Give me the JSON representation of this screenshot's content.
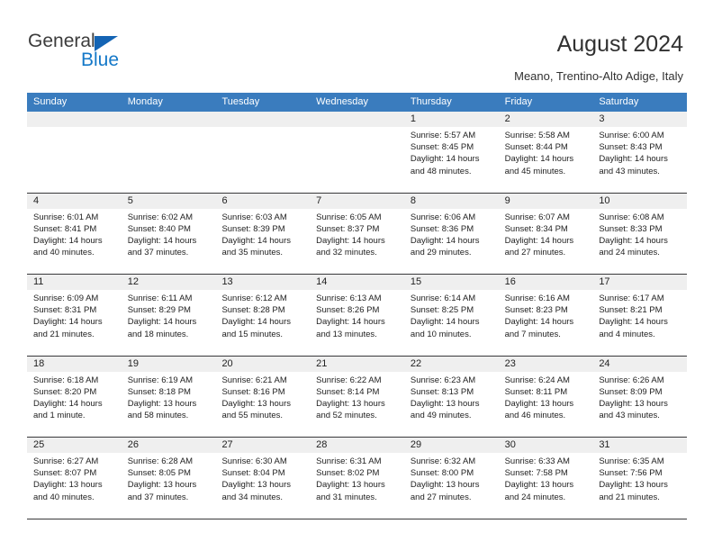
{
  "brand": {
    "name_top": "General",
    "name_bottom": "Blue",
    "triangle_icon": "brand-triangle-icon",
    "accent_blue": "#1478c8",
    "header_blue": "#3a7cbe"
  },
  "header": {
    "title": "August 2024",
    "subtitle": "Meano, Trentino-Alto Adige, Italy"
  },
  "calendar": {
    "weekdays": [
      "Sunday",
      "Monday",
      "Tuesday",
      "Wednesday",
      "Thursday",
      "Friday",
      "Saturday"
    ],
    "labels": {
      "sunrise": "Sunrise:",
      "sunset": "Sunset:",
      "daylight": "Daylight:"
    },
    "weeks": [
      [
        {
          "date": "",
          "empty": true
        },
        {
          "date": "",
          "empty": true
        },
        {
          "date": "",
          "empty": true
        },
        {
          "date": "",
          "empty": true
        },
        {
          "date": "1",
          "sunrise": "Sunrise: 5:57 AM",
          "sunset": "Sunset: 8:45 PM",
          "daylight": "Daylight: 14 hours and 48 minutes."
        },
        {
          "date": "2",
          "sunrise": "Sunrise: 5:58 AM",
          "sunset": "Sunset: 8:44 PM",
          "daylight": "Daylight: 14 hours and 45 minutes."
        },
        {
          "date": "3",
          "sunrise": "Sunrise: 6:00 AM",
          "sunset": "Sunset: 8:43 PM",
          "daylight": "Daylight: 14 hours and 43 minutes."
        }
      ],
      [
        {
          "date": "4",
          "sunrise": "Sunrise: 6:01 AM",
          "sunset": "Sunset: 8:41 PM",
          "daylight": "Daylight: 14 hours and 40 minutes."
        },
        {
          "date": "5",
          "sunrise": "Sunrise: 6:02 AM",
          "sunset": "Sunset: 8:40 PM",
          "daylight": "Daylight: 14 hours and 37 minutes."
        },
        {
          "date": "6",
          "sunrise": "Sunrise: 6:03 AM",
          "sunset": "Sunset: 8:39 PM",
          "daylight": "Daylight: 14 hours and 35 minutes."
        },
        {
          "date": "7",
          "sunrise": "Sunrise: 6:05 AM",
          "sunset": "Sunset: 8:37 PM",
          "daylight": "Daylight: 14 hours and 32 minutes."
        },
        {
          "date": "8",
          "sunrise": "Sunrise: 6:06 AM",
          "sunset": "Sunset: 8:36 PM",
          "daylight": "Daylight: 14 hours and 29 minutes."
        },
        {
          "date": "9",
          "sunrise": "Sunrise: 6:07 AM",
          "sunset": "Sunset: 8:34 PM",
          "daylight": "Daylight: 14 hours and 27 minutes."
        },
        {
          "date": "10",
          "sunrise": "Sunrise: 6:08 AM",
          "sunset": "Sunset: 8:33 PM",
          "daylight": "Daylight: 14 hours and 24 minutes."
        }
      ],
      [
        {
          "date": "11",
          "sunrise": "Sunrise: 6:09 AM",
          "sunset": "Sunset: 8:31 PM",
          "daylight": "Daylight: 14 hours and 21 minutes."
        },
        {
          "date": "12",
          "sunrise": "Sunrise: 6:11 AM",
          "sunset": "Sunset: 8:29 PM",
          "daylight": "Daylight: 14 hours and 18 minutes."
        },
        {
          "date": "13",
          "sunrise": "Sunrise: 6:12 AM",
          "sunset": "Sunset: 8:28 PM",
          "daylight": "Daylight: 14 hours and 15 minutes."
        },
        {
          "date": "14",
          "sunrise": "Sunrise: 6:13 AM",
          "sunset": "Sunset: 8:26 PM",
          "daylight": "Daylight: 14 hours and 13 minutes."
        },
        {
          "date": "15",
          "sunrise": "Sunrise: 6:14 AM",
          "sunset": "Sunset: 8:25 PM",
          "daylight": "Daylight: 14 hours and 10 minutes."
        },
        {
          "date": "16",
          "sunrise": "Sunrise: 6:16 AM",
          "sunset": "Sunset: 8:23 PM",
          "daylight": "Daylight: 14 hours and 7 minutes."
        },
        {
          "date": "17",
          "sunrise": "Sunrise: 6:17 AM",
          "sunset": "Sunset: 8:21 PM",
          "daylight": "Daylight: 14 hours and 4 minutes."
        }
      ],
      [
        {
          "date": "18",
          "sunrise": "Sunrise: 6:18 AM",
          "sunset": "Sunset: 8:20 PM",
          "daylight": "Daylight: 14 hours and 1 minute."
        },
        {
          "date": "19",
          "sunrise": "Sunrise: 6:19 AM",
          "sunset": "Sunset: 8:18 PM",
          "daylight": "Daylight: 13 hours and 58 minutes."
        },
        {
          "date": "20",
          "sunrise": "Sunrise: 6:21 AM",
          "sunset": "Sunset: 8:16 PM",
          "daylight": "Daylight: 13 hours and 55 minutes."
        },
        {
          "date": "21",
          "sunrise": "Sunrise: 6:22 AM",
          "sunset": "Sunset: 8:14 PM",
          "daylight": "Daylight: 13 hours and 52 minutes."
        },
        {
          "date": "22",
          "sunrise": "Sunrise: 6:23 AM",
          "sunset": "Sunset: 8:13 PM",
          "daylight": "Daylight: 13 hours and 49 minutes."
        },
        {
          "date": "23",
          "sunrise": "Sunrise: 6:24 AM",
          "sunset": "Sunset: 8:11 PM",
          "daylight": "Daylight: 13 hours and 46 minutes."
        },
        {
          "date": "24",
          "sunrise": "Sunrise: 6:26 AM",
          "sunset": "Sunset: 8:09 PM",
          "daylight": "Daylight: 13 hours and 43 minutes."
        }
      ],
      [
        {
          "date": "25",
          "sunrise": "Sunrise: 6:27 AM",
          "sunset": "Sunset: 8:07 PM",
          "daylight": "Daylight: 13 hours and 40 minutes."
        },
        {
          "date": "26",
          "sunrise": "Sunrise: 6:28 AM",
          "sunset": "Sunset: 8:05 PM",
          "daylight": "Daylight: 13 hours and 37 minutes."
        },
        {
          "date": "27",
          "sunrise": "Sunrise: 6:30 AM",
          "sunset": "Sunset: 8:04 PM",
          "daylight": "Daylight: 13 hours and 34 minutes."
        },
        {
          "date": "28",
          "sunrise": "Sunrise: 6:31 AM",
          "sunset": "Sunset: 8:02 PM",
          "daylight": "Daylight: 13 hours and 31 minutes."
        },
        {
          "date": "29",
          "sunrise": "Sunrise: 6:32 AM",
          "sunset": "Sunset: 8:00 PM",
          "daylight": "Daylight: 13 hours and 27 minutes."
        },
        {
          "date": "30",
          "sunrise": "Sunrise: 6:33 AM",
          "sunset": "Sunset: 7:58 PM",
          "daylight": "Daylight: 13 hours and 24 minutes."
        },
        {
          "date": "31",
          "sunrise": "Sunrise: 6:35 AM",
          "sunset": "Sunset: 7:56 PM",
          "daylight": "Daylight: 13 hours and 21 minutes."
        }
      ]
    ]
  }
}
